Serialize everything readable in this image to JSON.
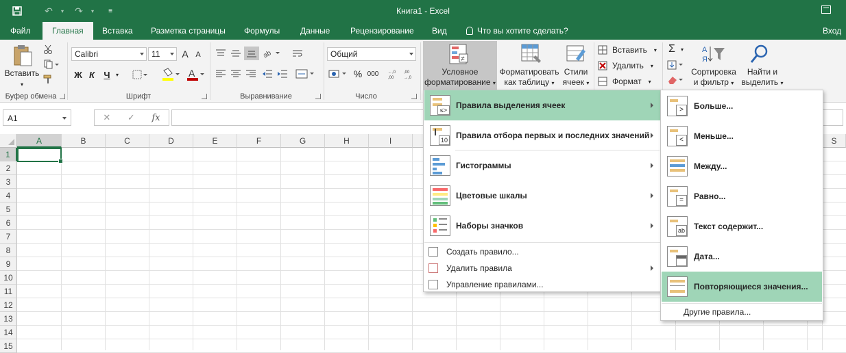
{
  "titlebar": {
    "title": "Книга1 - Excel"
  },
  "tabs": [
    {
      "label": "Файл"
    },
    {
      "label": "Главная"
    },
    {
      "label": "Вставка"
    },
    {
      "label": "Разметка страницы"
    },
    {
      "label": "Формулы"
    },
    {
      "label": "Данные"
    },
    {
      "label": "Рецензирование"
    },
    {
      "label": "Вид"
    },
    {
      "label": "Что вы хотите сделать?"
    },
    {
      "label": "Вход"
    }
  ],
  "ribbon": {
    "paste_label": "Вставить",
    "clipboard_group": "Буфер обмена",
    "font_name": "Calibri",
    "font_size": "11",
    "font_group": "Шрифт",
    "bold": "Ж",
    "italic": "К",
    "underline": "Ч",
    "grow_font": "A",
    "shrink_font": "A",
    "font_color": "A",
    "align_group": "Выравнивание",
    "number_format": "Общий",
    "number_group": "Число",
    "percent": "%",
    "thousands": "000",
    "cond_format_line1": "Условное",
    "cond_format_line2": "форматирование",
    "format_table_line1": "Форматировать",
    "format_table_line2": "как таблицу",
    "styles_line1": "Стили",
    "styles_line2": "ячеек",
    "insert": "Вставить",
    "delete": "Удалить",
    "format": "Формат",
    "sort_line1": "Сортировка",
    "sort_line2": "и фильтр",
    "find_line1": "Найти и",
    "find_line2": "выделить",
    "sigma": "Σ"
  },
  "formula_bar": {
    "name_box": "A1",
    "cancel": "✕",
    "enter": "✓",
    "fx": "fx"
  },
  "grid": {
    "columns": [
      "A",
      "B",
      "C",
      "D",
      "E",
      "F",
      "G",
      "H",
      "I",
      "S"
    ],
    "rows": [
      "1",
      "2",
      "3",
      "4",
      "5",
      "6",
      "7",
      "8",
      "9",
      "10",
      "11",
      "12",
      "13",
      "14",
      "15"
    ]
  },
  "cf_menu": {
    "items": [
      {
        "label": "Правила выделения ячеек"
      },
      {
        "label": "Правила отбора первых и последних значений"
      },
      {
        "label": "Гистограммы"
      },
      {
        "label": "Цветовые шкалы"
      },
      {
        "label": "Наборы значков"
      }
    ],
    "small_items": [
      {
        "label": "Создать правило..."
      },
      {
        "label": "Удалить правила"
      },
      {
        "label": "Управление правилами..."
      }
    ],
    "top10_icon_text": "10"
  },
  "submenu": {
    "items": [
      {
        "label": "Больше...",
        "icon_glyph": ">"
      },
      {
        "label": "Меньше...",
        "icon_glyph": "<"
      },
      {
        "label": "Между...",
        "icon_glyph": ""
      },
      {
        "label": "Равно...",
        "icon_glyph": "="
      },
      {
        "label": "Текст содержит...",
        "icon_glyph": "ab"
      },
      {
        "label": "Дата...",
        "icon_glyph": ""
      },
      {
        "label": "Повторяющиеся значения...",
        "icon_glyph": ""
      }
    ],
    "other": "Другие правила..."
  },
  "colors": {
    "excel_green": "#217346",
    "menu_highlight": "#9fd5b7"
  }
}
